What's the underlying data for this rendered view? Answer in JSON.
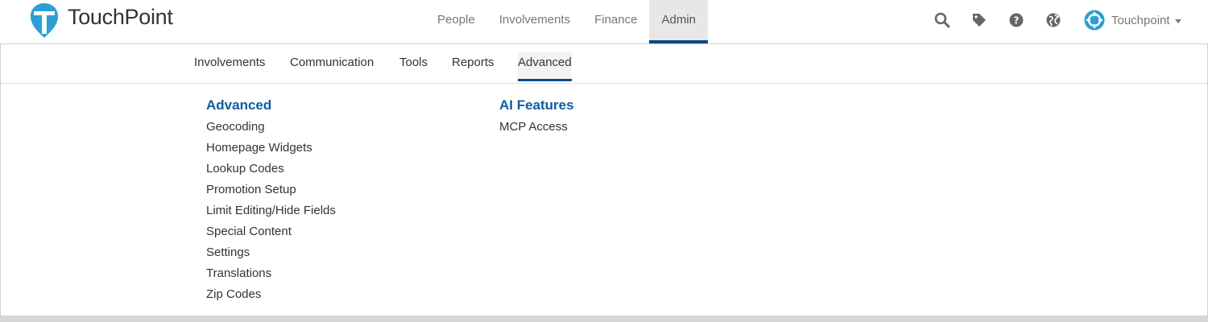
{
  "app": {
    "logo_text": "TouchPoint"
  },
  "main_nav": {
    "items": [
      {
        "label": "People"
      },
      {
        "label": "Involvements"
      },
      {
        "label": "Finance"
      },
      {
        "label": "Admin",
        "active": true
      }
    ]
  },
  "toolbar": {
    "icons": [
      "search-icon",
      "tag-icon",
      "help-icon",
      "globe-icon"
    ]
  },
  "user": {
    "name": "Touchpoint"
  },
  "sub_nav": {
    "items": [
      {
        "label": "Involvements"
      },
      {
        "label": "Communication"
      },
      {
        "label": "Tools"
      },
      {
        "label": "Reports"
      },
      {
        "label": "Advanced",
        "active": true
      }
    ]
  },
  "columns": [
    {
      "heading": "Advanced",
      "links": [
        "Geocoding",
        "Homepage Widgets",
        "Lookup Codes",
        "Promotion Setup",
        "Limit Editing/Hide Fields",
        "Special Content",
        "Settings",
        "Translations",
        "Zip Codes"
      ]
    },
    {
      "heading": "AI Features",
      "links": [
        "MCP Access"
      ]
    }
  ],
  "colors": {
    "brand_blue": "#2a9fd8",
    "accent_navy": "#004b85",
    "heading_blue": "#0b5da6"
  }
}
